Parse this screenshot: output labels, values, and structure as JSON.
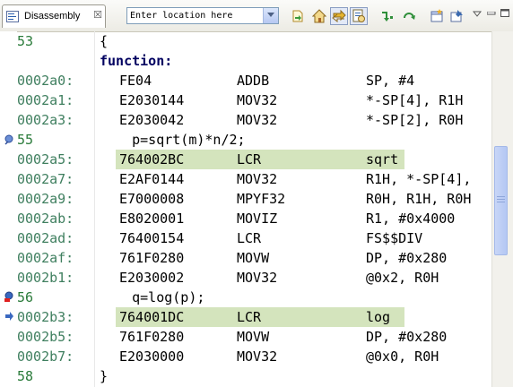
{
  "tab": {
    "label": "Disassembly",
    "close_glyph": "☒"
  },
  "location": {
    "placeholder": "Enter location here",
    "value": ""
  },
  "toolbar_icons": [
    "goto-pc-icon",
    "home-icon",
    "link-with-editor-icon",
    "show-source-icon",
    "step-into-icon",
    "refresh-icon",
    "new-view-icon",
    "pin-icon",
    "view-menu-icon"
  ],
  "lines": [
    {
      "kind": "source",
      "lineno": "53",
      "text": "{"
    },
    {
      "kind": "function",
      "text": "function:"
    },
    {
      "kind": "asm",
      "addr": "0002a0:",
      "opcode": "FE04",
      "mnemonic": "ADDB",
      "operands": "SP, #4"
    },
    {
      "kind": "asm",
      "addr": "0002a1:",
      "opcode": "E2030144",
      "mnemonic": "MOV32",
      "operands": "*-SP[4], R1H"
    },
    {
      "kind": "asm",
      "addr": "0002a3:",
      "opcode": "E2030042",
      "mnemonic": "MOV32",
      "operands": "*-SP[2], R0H"
    },
    {
      "kind": "source",
      "lineno": "55",
      "text": "    p=sqrt(m)*n/2;",
      "marker": "bookmark"
    },
    {
      "kind": "asm",
      "addr": "0002a5:",
      "opcode": "764002BC",
      "mnemonic": "LCR",
      "operands": "sqrt",
      "highlight": true
    },
    {
      "kind": "asm",
      "addr": "0002a7:",
      "opcode": "E2AF0144",
      "mnemonic": "MOV32",
      "operands": "R1H, *-SP[4],"
    },
    {
      "kind": "asm",
      "addr": "0002a9:",
      "opcode": "E7000008",
      "mnemonic": "MPYF32",
      "operands": "R0H, R1H, R0H"
    },
    {
      "kind": "asm",
      "addr": "0002ab:",
      "opcode": "E8020001",
      "mnemonic": "MOVIZ",
      "operands": "R1, #0x4000"
    },
    {
      "kind": "asm",
      "addr": "0002ad:",
      "opcode": "76400154",
      "mnemonic": "LCR",
      "operands": "FS$$DIV"
    },
    {
      "kind": "asm",
      "addr": "0002af:",
      "opcode": "761F0280",
      "mnemonic": "MOVW",
      "operands": "DP, #0x280"
    },
    {
      "kind": "asm",
      "addr": "0002b1:",
      "opcode": "E2030002",
      "mnemonic": "MOV32",
      "operands": "@0x2, R0H"
    },
    {
      "kind": "source",
      "lineno": "56",
      "text": "    q=log(p);",
      "marker": "breakpoint"
    },
    {
      "kind": "asm",
      "addr": "0002b3:",
      "opcode": "764001DC",
      "mnemonic": "LCR",
      "operands": "log",
      "highlight": true,
      "marker": "pc-arrow"
    },
    {
      "kind": "asm",
      "addr": "0002b5:",
      "opcode": "761F0280",
      "mnemonic": "MOVW",
      "operands": "DP, #0x280"
    },
    {
      "kind": "asm",
      "addr": "0002b7:",
      "opcode": "E2030000",
      "mnemonic": "MOV32",
      "operands": "@0x0, R0H"
    },
    {
      "kind": "source",
      "lineno": "58",
      "text": "}"
    }
  ],
  "colors": {
    "address": "#3f7f5f",
    "highlight": "#d4e4bd",
    "keyword": "#000060"
  }
}
